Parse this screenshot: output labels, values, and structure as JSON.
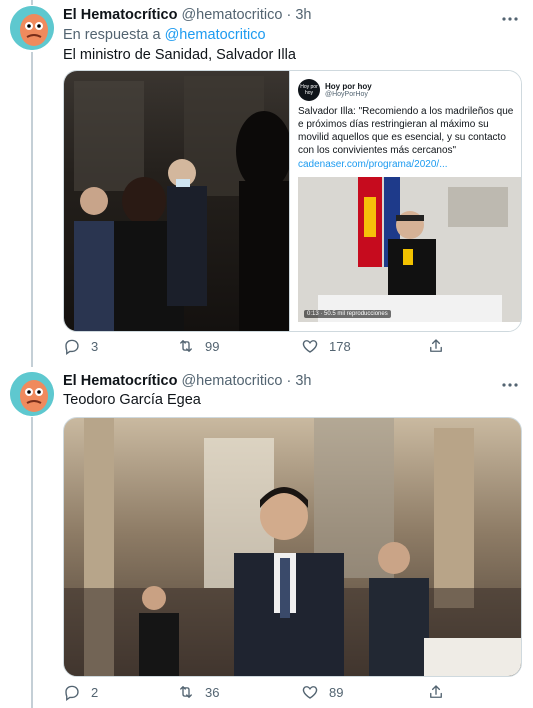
{
  "tweets": [
    {
      "author_name": "El Hematocrítico",
      "handle": "@hematocritico",
      "dot": "·",
      "time": "3h",
      "reply_prefix": "En respuesta a",
      "reply_to": "@hematocritico",
      "text": "El ministro de Sanidad, Salvador Illa",
      "quote": {
        "logo_text": "Hoy por hoy",
        "name": "Hoy por hoy",
        "handle": "@HoyPorHoy",
        "text": "Salvador Illa: \"Recomiendo a los madrileños que e próximos días restringieran al máximo su movilid aquellos que es esencial, y su contacto con los convivientes más cercanos\"",
        "link": "cadenaser.com/programa/2020/...",
        "views": "0:13 · 50.5 mil reproducciones"
      },
      "counts": {
        "replies": "3",
        "retweets": "99",
        "likes": "178"
      }
    },
    {
      "author_name": "El Hematocrítico",
      "handle": "@hematocritico",
      "dot": "·",
      "time": "3h",
      "text": "Teodoro García Egea",
      "counts": {
        "replies": "2",
        "retweets": "36",
        "likes": "89"
      }
    }
  ],
  "icons": {
    "more": "more-icon",
    "reply": "reply-icon",
    "retweet": "retweet-icon",
    "like": "like-icon",
    "share": "share-icon"
  },
  "colors": {
    "link": "#1d9bf0",
    "secondary": "#536471",
    "avatar_bg": "#5ec8cf"
  }
}
